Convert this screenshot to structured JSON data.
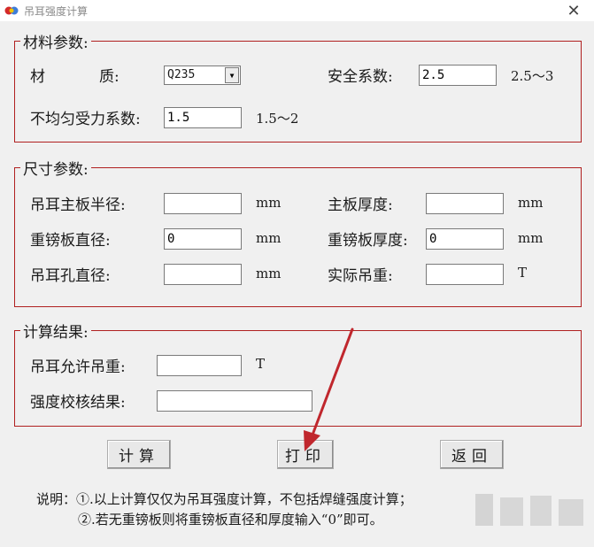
{
  "window": {
    "title": "吊耳强度计算",
    "close_glyph": "✕"
  },
  "material": {
    "legend": "材料参数:",
    "material_label_a": "材",
    "material_label_b": "质:",
    "material_value": "Q235",
    "safety_label": "安全系数:",
    "safety_value": "2.5",
    "safety_range": "2.5～3",
    "uneven_label": "不均匀受力系数:",
    "uneven_value": "1.5",
    "uneven_range": "1.5～2"
  },
  "dimension": {
    "legend": "尺寸参数:",
    "main_radius_label": "吊耳主板半径:",
    "main_radius_value": "",
    "main_radius_unit": "mm",
    "main_thickness_label": "主板厚度:",
    "main_thickness_value": "",
    "main_thickness_unit": "mm",
    "pad_diameter_label": "重镑板直径:",
    "pad_diameter_value": "0",
    "pad_diameter_unit": "mm",
    "pad_thickness_label": "重镑板厚度:",
    "pad_thickness_value": "0",
    "pad_thickness_unit": "mm",
    "hole_diameter_label": "吊耳孔直径:",
    "hole_diameter_value": "",
    "hole_diameter_unit": "mm",
    "actual_load_label": "实际吊重:",
    "actual_load_value": "",
    "actual_load_unit": "T"
  },
  "result": {
    "legend": "计算结果:",
    "allowed_load_label": "吊耳允许吊重:",
    "allowed_load_value": "",
    "allowed_load_unit": "T",
    "check_label": "强度校核结果:",
    "check_value": ""
  },
  "buttons": {
    "calculate": "计算",
    "print": "打印",
    "back": "返回"
  },
  "notes": {
    "line1": "说明：①.以上计算仅仅为吊耳强度计算，不包括焊缝强度计算；",
    "line2": "②.若无重镑板则将重镑板直径和厚度输入“0”即可。"
  },
  "colors": {
    "group_border": "#b02020",
    "arrow": "#c0272d"
  },
  "icons": {
    "app": "app-logo-icon",
    "close": "close-icon",
    "dropdown": "chevron-down-icon"
  }
}
